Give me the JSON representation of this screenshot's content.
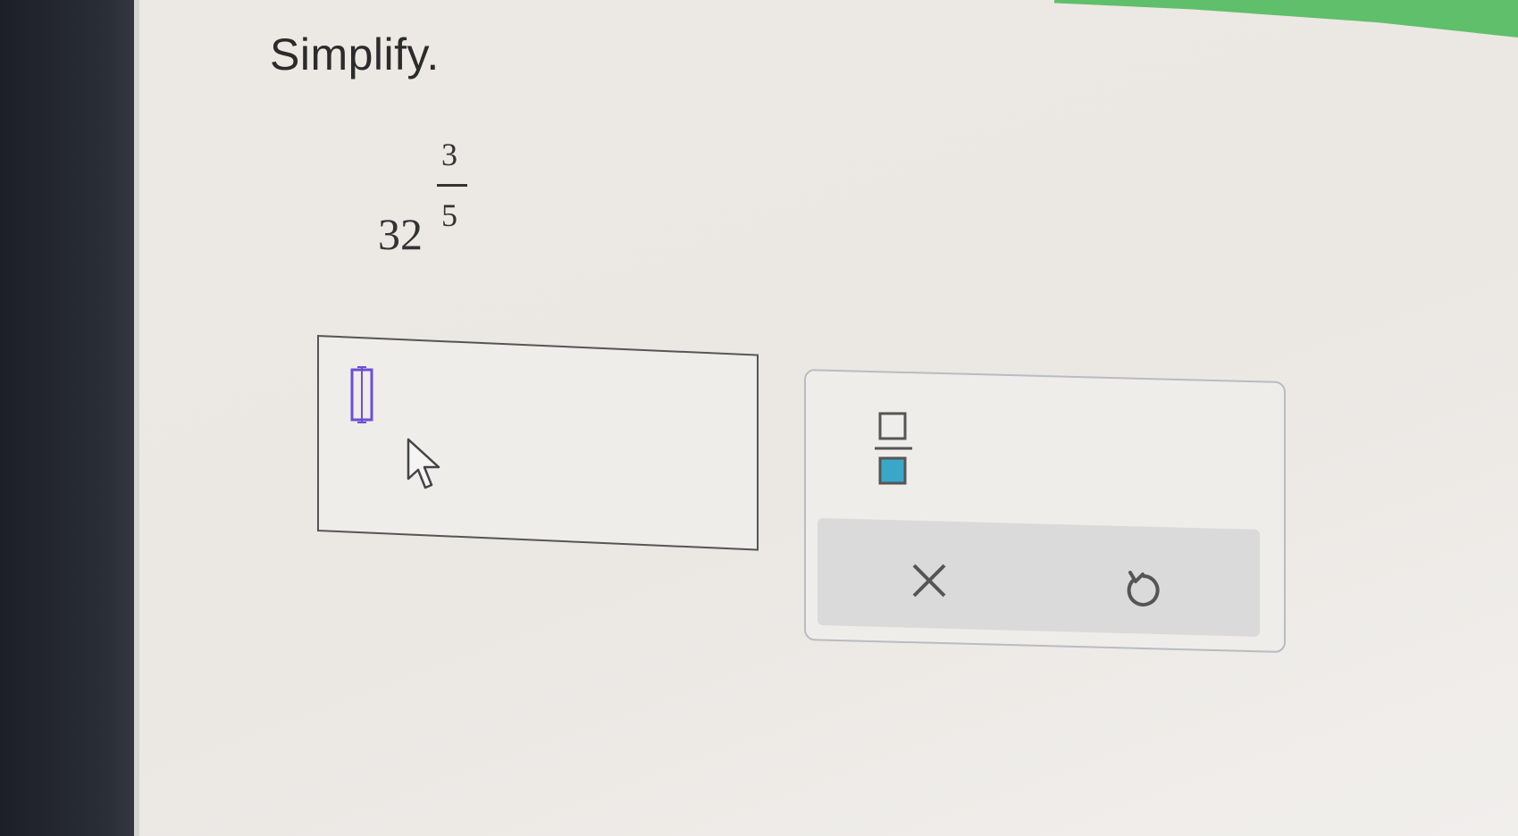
{
  "question": {
    "instruction": "Simplify.",
    "base": "32",
    "exponent_numerator": "3",
    "exponent_denominator": "5"
  },
  "answer": {
    "value": ""
  },
  "palette": {
    "icons": [
      "fraction-template-icon",
      "clear-icon",
      "undo-icon"
    ]
  },
  "colors": {
    "accent_green": "#5fbf6a",
    "cursor_purple": "#6a4fd8",
    "fraction_teal": "#3aa7c9"
  }
}
